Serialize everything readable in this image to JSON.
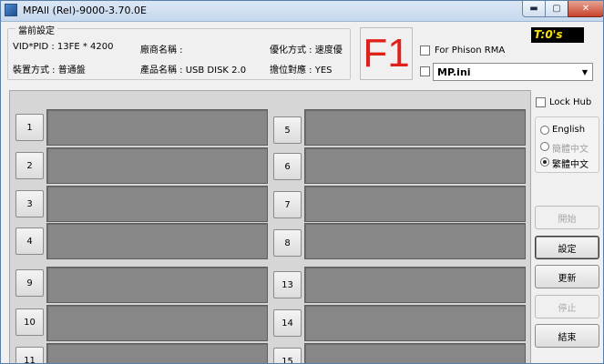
{
  "window": {
    "title": "MPAll (Rel)-9000-3.70.0E",
    "controls": {
      "minimize": "▬",
      "maximize": "▢",
      "close": "✕"
    }
  },
  "settings": {
    "legend": "當前設定",
    "vid_pid": "VID*PID : 13FE * 4200",
    "manufacturer": "廠商名稱 :",
    "optimize": "優化方式 : 速度優",
    "install": "裝置方式 : 普通盤",
    "product": "產品名稱 : USB DISK 2.0",
    "reset": "擔位對應 : YES"
  },
  "f_code": "F1",
  "phison_rma": {
    "label": "For Phison RMA",
    "checked": false
  },
  "ini_file": {
    "checked": false,
    "value": "MP.ini"
  },
  "timer": "T:0's",
  "ports": [
    {
      "label": "1"
    },
    {
      "label": "2"
    },
    {
      "label": "3"
    },
    {
      "label": "4"
    },
    {
      "label": "5"
    },
    {
      "label": "6"
    },
    {
      "label": "7"
    },
    {
      "label": "8"
    },
    {
      "label": "9"
    },
    {
      "label": "10"
    },
    {
      "label": "11"
    },
    {
      "label": "13"
    },
    {
      "label": "14"
    },
    {
      "label": "15"
    }
  ],
  "lock_hub": {
    "label": "Lock Hub",
    "checked": false
  },
  "language": {
    "options": [
      {
        "label": "English",
        "selected": false,
        "enabled": true
      },
      {
        "label": "簡體中文",
        "selected": false,
        "enabled": false
      },
      {
        "label": "繁體中文",
        "selected": true,
        "enabled": true
      }
    ]
  },
  "actions": {
    "start": "開始",
    "settings": "設定",
    "update": "更新",
    "stop": "停止",
    "exit": "結束"
  }
}
